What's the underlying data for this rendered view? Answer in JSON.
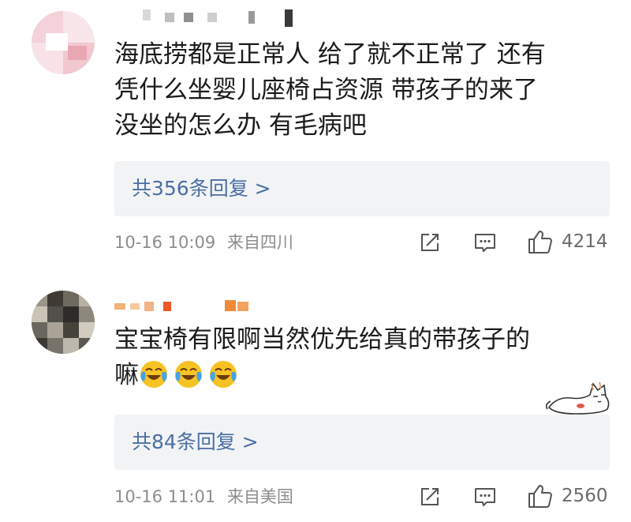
{
  "comments": [
    {
      "text_lines": [
        "海底捞都是正常人 给了就不正常了 还有",
        "凭什么坐婴儿座椅占资源 带孩子的来了",
        "没坐的怎么办 有毛病吧"
      ],
      "replies_label": "共356条回复 >",
      "time": "10-16 10:09",
      "location": "来自四川",
      "likes": "4214",
      "avatar_icon": "pixelated-avatar-icon",
      "icons": [
        "repost-icon",
        "comment-icon",
        "like-icon"
      ]
    },
    {
      "text_lines": [
        "宝宝椅有限啊当然优先给真的带孩子的",
        "嘛"
      ],
      "replies_label": "共84条回复 >",
      "time": "10-16 11:01",
      "location": "来自美国",
      "likes": "2560",
      "avatar_icon": "pixelated-avatar-icon",
      "emoji_icons": [
        "laugh-cry-emoji-icon",
        "laugh-cry-emoji-icon",
        "laugh-cry-emoji-icon"
      ],
      "sticker_icon": "lazy-cat-sticker-icon",
      "icons": [
        "repost-icon",
        "comment-icon",
        "like-icon"
      ]
    }
  ],
  "colors": {
    "link_blue": "#4a6fa5",
    "meta_gray": "#8d8d8d",
    "reply_box_bg": "#f2f3f5",
    "text": "#1b1b1b"
  }
}
